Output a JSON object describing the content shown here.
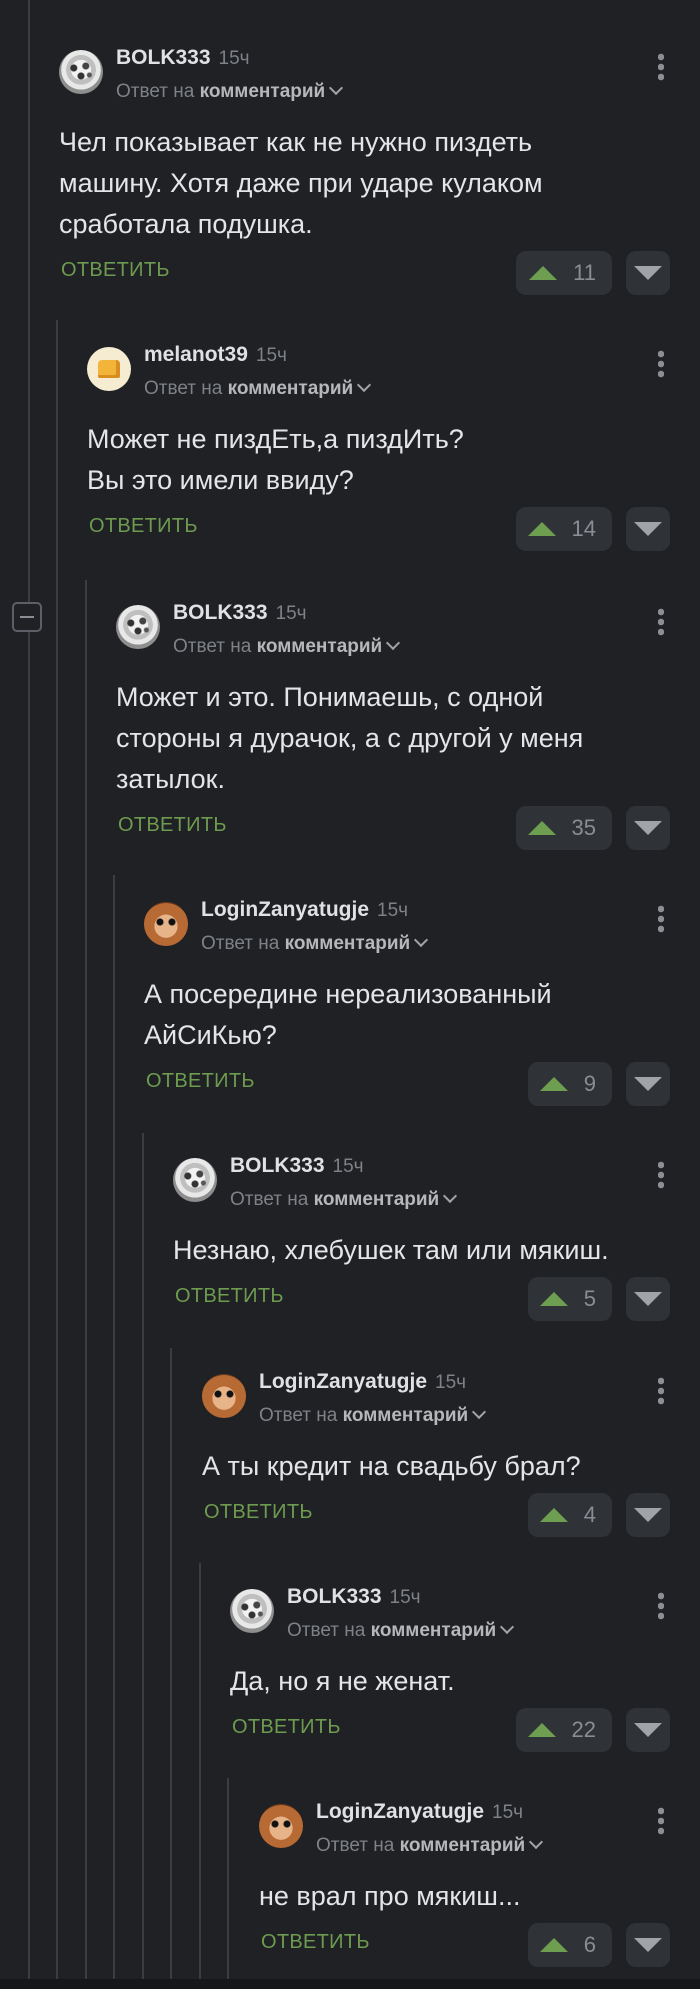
{
  "reply_to_prefix": "Ответ на",
  "reply_to_target": "комментарий",
  "reply_label": "ОТВЕТИТЬ",
  "comments": [
    {
      "author": "BOLK333",
      "time": "15ч",
      "avatar": "snow-leopard",
      "text": "Чел показывает как не нужно пиздеть\nмашину. Хотя даже при ударе кулаком\nсработала подушка.",
      "votes": "11"
    },
    {
      "author": "melanot39",
      "time": "15ч",
      "avatar": "cheese",
      "text": "Может не пиздЕть,а пиздИть?\nВы это имели ввиду?",
      "votes": "14"
    },
    {
      "author": "BOLK333",
      "time": "15ч",
      "avatar": "snow-leopard",
      "text": "Может и это. Понимаешь, с одной\nстороны я дурачок, а с другой у меня\nзатылок.",
      "votes": "35"
    },
    {
      "author": "LoginZanyatugje",
      "time": "15ч",
      "avatar": "hamster",
      "text": "А посередине нереализованный\nАйСиКью?",
      "votes": "9"
    },
    {
      "author": "BOLK333",
      "time": "15ч",
      "avatar": "snow-leopard",
      "text": "Незнаю, хлебушек там или мякиш.",
      "votes": "5"
    },
    {
      "author": "LoginZanyatugje",
      "time": "15ч",
      "avatar": "hamster",
      "text": "А ты кредит на свадьбу брал?",
      "votes": "4"
    },
    {
      "author": "BOLK333",
      "time": "15ч",
      "avatar": "snow-leopard",
      "text": "Да, но я не женат.",
      "votes": "22"
    },
    {
      "author": "LoginZanyatugje",
      "time": "15ч",
      "avatar": "hamster",
      "text": "не врал про мякиш...",
      "votes": "6"
    }
  ]
}
